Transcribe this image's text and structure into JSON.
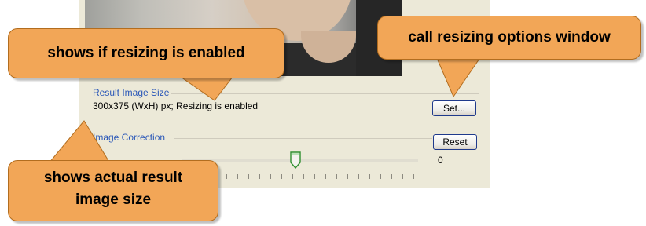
{
  "result_image_size": {
    "group_title": "Result Image Size",
    "size_text": "300x375 (WxH) px; Resizing is enabled",
    "set_button": "Set..."
  },
  "image_correction": {
    "group_title": "Image Correction",
    "reset_button": "Reset",
    "slider_value": "0"
  },
  "callouts": {
    "resizing_enabled": "shows if resizing is enabled",
    "options_window": "call resizing options window",
    "actual_size_line1": "shows actual result",
    "actual_size_line2": "image size"
  },
  "colors": {
    "callout_fill": "#f2a657",
    "callout_border": "#b26d1f",
    "panel_bg": "#ece9d8",
    "group_title": "#2b58b8"
  }
}
